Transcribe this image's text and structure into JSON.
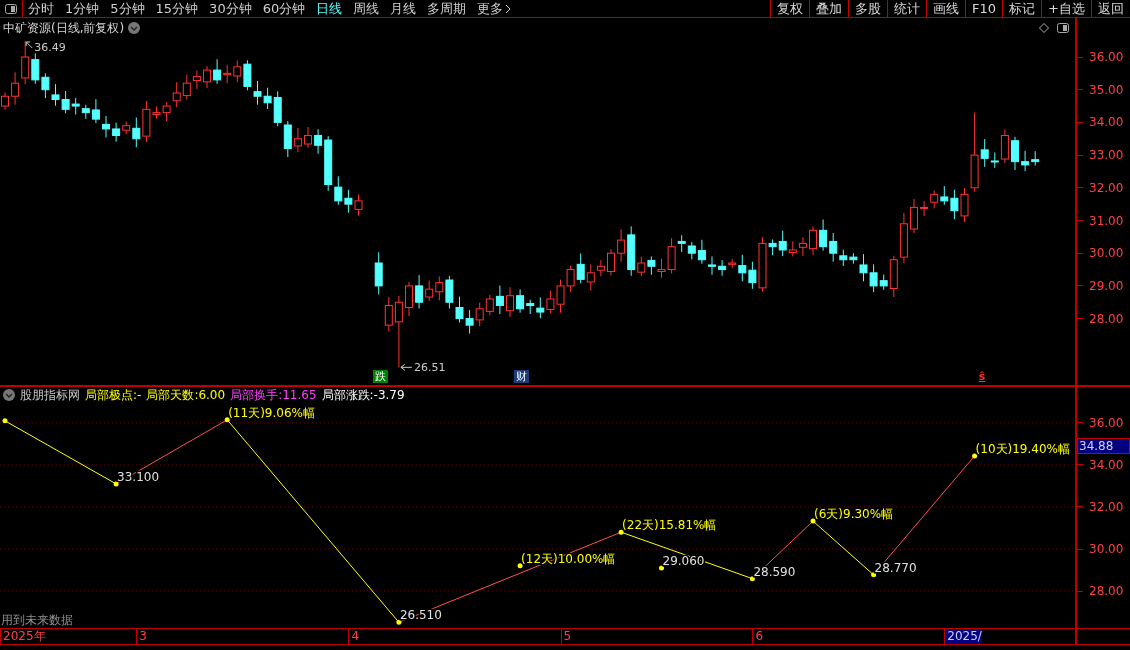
{
  "toolbar": {
    "periods": [
      {
        "label": "分时",
        "selected": false
      },
      {
        "label": "1分钟",
        "selected": false
      },
      {
        "label": "5分钟",
        "selected": false
      },
      {
        "label": "15分钟",
        "selected": false
      },
      {
        "label": "30分钟",
        "selected": false
      },
      {
        "label": "60分钟",
        "selected": false
      },
      {
        "label": "日线",
        "selected": true
      },
      {
        "label": "周线",
        "selected": false
      },
      {
        "label": "月线",
        "selected": false
      },
      {
        "label": "多周期",
        "selected": false
      },
      {
        "label": "更多",
        "selected": false
      }
    ],
    "buttons": [
      "复权",
      "叠加",
      "多股",
      "统计",
      "画线",
      "F10",
      "标记",
      "+自选",
      "返回"
    ]
  },
  "main_chart": {
    "title": "中矿资源(日线,前复权)",
    "yticks": [
      "36.00",
      "35.00",
      "34.00",
      "33.00",
      "32.00",
      "31.00",
      "30.00",
      "29.00",
      "28.00"
    ],
    "markers": [
      {
        "text": "36.49",
        "kind": "high"
      },
      {
        "text": "26.51",
        "kind": "low"
      }
    ],
    "badges": [
      {
        "text": "跌",
        "kind": "fall"
      },
      {
        "text": "财",
        "kind": "finance"
      },
      {
        "text": "ŝ",
        "kind": "signal"
      }
    ]
  },
  "indicator": {
    "name": "股朋指标网",
    "fields": [
      {
        "text": "局部极点:-",
        "color": "#ffff00"
      },
      {
        "text": "局部天数:6.00",
        "color": "#ffff00"
      },
      {
        "text": "局部换手:11.65",
        "color": "#ff40ff"
      },
      {
        "text": "局部涨跌:-3.79",
        "color": "#ffffff"
      }
    ],
    "current": "34.88",
    "yticks": [
      "36.00",
      "34.00",
      "32.00",
      "30.00",
      "28.00"
    ],
    "point_labels": [
      {
        "text": "33.100",
        "kind": "price"
      },
      {
        "text": "(11天)9.06%幅",
        "kind": "swing"
      },
      {
        "text": "26.510",
        "kind": "price"
      },
      {
        "text": "(12天)10.00%幅",
        "kind": "swing"
      },
      {
        "text": "(22天)15.81%幅",
        "kind": "swing"
      },
      {
        "text": "29.060",
        "kind": "price"
      },
      {
        "text": "28.590",
        "kind": "price"
      },
      {
        "text": "(6天)9.30%幅",
        "kind": "swing"
      },
      {
        "text": "28.770",
        "kind": "price"
      },
      {
        "text": "(10天)19.40%幅",
        "kind": "swing"
      }
    ]
  },
  "note": "用到未来数据",
  "time_axis": [
    {
      "label": "2025年",
      "selected": false
    },
    {
      "label": "3",
      "selected": false
    },
    {
      "label": "4",
      "selected": false
    },
    {
      "label": "5",
      "selected": false
    },
    {
      "label": "6",
      "selected": false
    },
    {
      "label": "2025/",
      "selected": true
    }
  ]
}
